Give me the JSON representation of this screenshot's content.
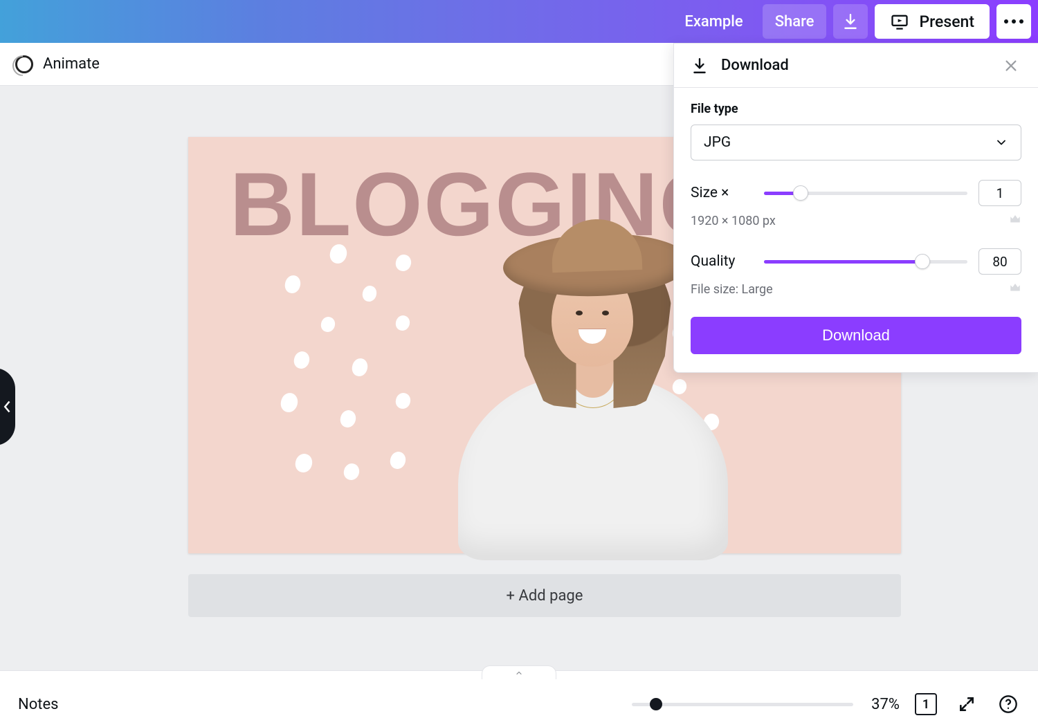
{
  "topbar": {
    "project_name": "Example",
    "share_label": "Share",
    "present_label": "Present"
  },
  "toolbar": {
    "animate_label": "Animate"
  },
  "canvas": {
    "headline": "BLOGGING T",
    "add_page_label": "+ Add page"
  },
  "download_panel": {
    "title": "Download",
    "file_type_label": "File type",
    "file_type_value": "JPG",
    "size_label": "Size ×",
    "size_value": "1",
    "size_slider_pct": 18,
    "dimensions": "1920 × 1080 px",
    "quality_label": "Quality",
    "quality_value": "80",
    "quality_slider_pct": 78,
    "file_size_note": "File size: Large",
    "action_label": "Download"
  },
  "footer": {
    "notes_label": "Notes",
    "zoom_label": "37%",
    "zoom_pct": 11,
    "page_count": "1"
  }
}
